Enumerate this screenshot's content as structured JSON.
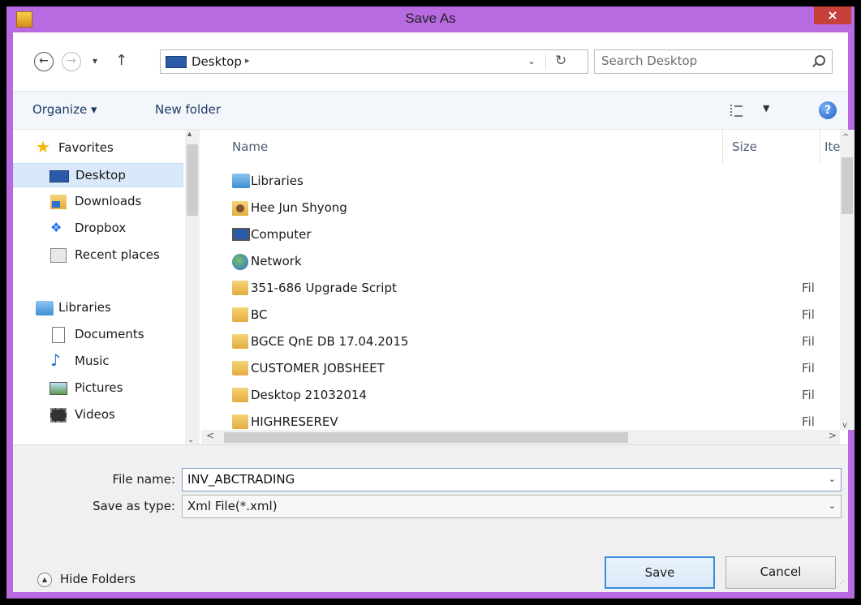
{
  "window": {
    "title": "Save As",
    "close_glyph": "×"
  },
  "address": {
    "location": "Desktop",
    "separator": "▸",
    "dropdown_glyph": "⌄",
    "refresh_glyph": "↻",
    "back_glyph": "←",
    "forward_glyph": "→",
    "recent_glyph": "▾",
    "up_glyph": "↑"
  },
  "search": {
    "placeholder": "Search Desktop"
  },
  "toolbar": {
    "organize_label": "Organize ▾",
    "new_folder_label": "New folder",
    "views_drop_glyph": "▼",
    "help_glyph": "?"
  },
  "nav": {
    "items": [
      {
        "label": "Favorites",
        "icon": "star-icon"
      },
      {
        "label": "Desktop",
        "icon": "desktop-icon"
      },
      {
        "label": "Downloads",
        "icon": "downloads-icon"
      },
      {
        "label": "Dropbox",
        "icon": "dropbox-icon"
      },
      {
        "label": "Recent places",
        "icon": "recent-places-icon"
      },
      {
        "label": "Libraries",
        "icon": "libraries-icon"
      },
      {
        "label": "Documents",
        "icon": "documents-icon"
      },
      {
        "label": "Music",
        "icon": "music-icon"
      },
      {
        "label": "Pictures",
        "icon": "pictures-icon"
      },
      {
        "label": "Videos",
        "icon": "videos-icon"
      }
    ],
    "selected": "Desktop",
    "scroll_up": "▴",
    "scroll_down": "⌄"
  },
  "filelist": {
    "columns": [
      "Name",
      "Size",
      "Ite"
    ],
    "rows": [
      {
        "name": "Libraries",
        "type": ""
      },
      {
        "name": "Hee Jun Shyong",
        "type": ""
      },
      {
        "name": "Computer",
        "type": ""
      },
      {
        "name": "Network",
        "type": ""
      },
      {
        "name": "351-686 Upgrade Script",
        "type": "Fil"
      },
      {
        "name": "BC",
        "type": "Fil"
      },
      {
        "name": "BGCE QnE DB 17.04.2015",
        "type": "Fil"
      },
      {
        "name": "CUSTOMER JOBSHEET",
        "type": "Fil"
      },
      {
        "name": "Desktop 21032014",
        "type": "Fil"
      },
      {
        "name": "HIGHRESEREV",
        "type": "Fil"
      }
    ],
    "scroll_up": "^",
    "scroll_down": "v",
    "scroll_left": "<",
    "scroll_right": ">"
  },
  "form": {
    "file_name_label": "File name:",
    "file_name_value": "INV_ABCTRADING",
    "save_type_label": "Save as type:",
    "save_type_value": "Xml File(*.xml)",
    "dropdown_glyph": "⌄"
  },
  "footer": {
    "hide_folders_label": "Hide Folders",
    "hide_folders_glyph": "▲",
    "save_label": "Save",
    "cancel_label": "Cancel",
    "grip_glyph": "⋰"
  },
  "colors": {
    "title_bar": "#b86ae0",
    "selection": "#d9e8fb",
    "accent": "#3c8ee0"
  }
}
